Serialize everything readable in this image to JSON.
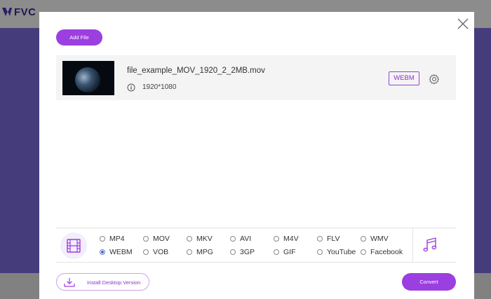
{
  "background": {
    "logo_text": "FVC"
  },
  "modal": {
    "add_file_label": "Add File",
    "file": {
      "name": "file_example_MOV_1920_2_2MB.mov",
      "resolution": "1920*1080",
      "output_format": "WEBM"
    },
    "formats": [
      {
        "label": "MP4",
        "checked": false
      },
      {
        "label": "MOV",
        "checked": false
      },
      {
        "label": "MKV",
        "checked": false
      },
      {
        "label": "AVI",
        "checked": false
      },
      {
        "label": "M4V",
        "checked": false
      },
      {
        "label": "FLV",
        "checked": false
      },
      {
        "label": "WMV",
        "checked": false
      },
      {
        "label": "WEBM",
        "checked": true
      },
      {
        "label": "VOB",
        "checked": false
      },
      {
        "label": "MPG",
        "checked": false
      },
      {
        "label": "3GP",
        "checked": false
      },
      {
        "label": "GIF",
        "checked": false
      },
      {
        "label": "YouTube",
        "checked": false
      },
      {
        "label": "Facebook",
        "checked": false
      }
    ],
    "install_label": "Install Desktop Version",
    "convert_label": "Convert"
  },
  "colors": {
    "accent": "#9b3fe0",
    "hero": "#7f6fe0"
  },
  "icons": {
    "close": "close-icon",
    "info": "info-icon",
    "settings": "gear-icon",
    "video_tab": "film-icon",
    "audio_tab": "music-note-icon",
    "install": "download-icon"
  }
}
